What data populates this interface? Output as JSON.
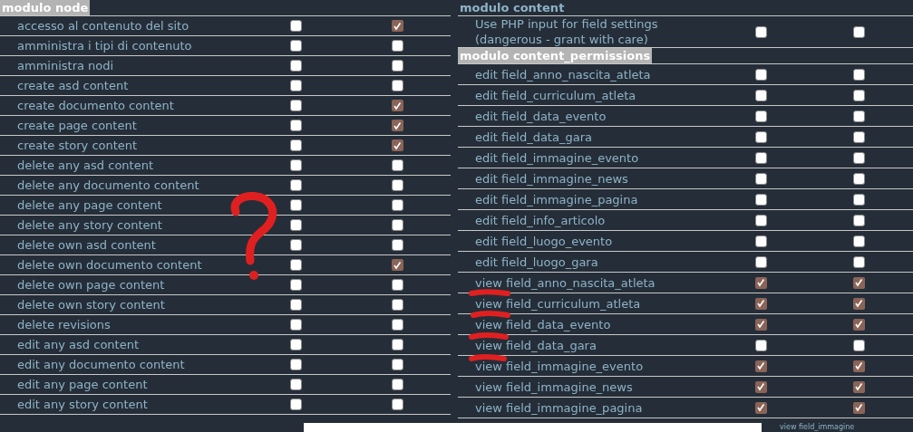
{
  "left_panel": {
    "sections": [
      {
        "title": "modulo node",
        "highlighted": true,
        "rows": [
          {
            "label": "accesso al contenuto del sito",
            "checkboxes": [
              {
                "checked": false
              },
              {
                "checked": true
              }
            ]
          },
          {
            "label": "amministra i tipi di contenuto",
            "checkboxes": [
              {
                "checked": false
              },
              {
                "checked": false
              }
            ]
          },
          {
            "label": "amministra nodi",
            "checkboxes": [
              {
                "checked": false
              },
              {
                "checked": false
              }
            ]
          },
          {
            "label": "create asd content",
            "checkboxes": [
              {
                "checked": false
              },
              {
                "checked": false
              }
            ]
          },
          {
            "label": "create documento content",
            "checkboxes": [
              {
                "checked": false
              },
              {
                "checked": true
              }
            ]
          },
          {
            "label": "create page content",
            "checkboxes": [
              {
                "checked": false
              },
              {
                "checked": true
              }
            ]
          },
          {
            "label": "create story content",
            "checkboxes": [
              {
                "checked": false
              },
              {
                "checked": true
              }
            ]
          },
          {
            "label": "delete any asd content",
            "checkboxes": [
              {
                "checked": false
              },
              {
                "checked": false
              }
            ]
          },
          {
            "label": "delete any documento content",
            "checkboxes": [
              {
                "checked": false
              },
              {
                "checked": false
              }
            ]
          },
          {
            "label": "delete any page content",
            "checkboxes": [
              {
                "checked": false
              },
              {
                "checked": false
              }
            ]
          },
          {
            "label": "delete any story content",
            "checkboxes": [
              {
                "checked": false
              },
              {
                "checked": false
              }
            ]
          },
          {
            "label": "delete own asd content",
            "checkboxes": [
              {
                "checked": false
              },
              {
                "checked": false
              }
            ]
          },
          {
            "label": "delete own documento content",
            "checkboxes": [
              {
                "checked": false
              },
              {
                "checked": true
              }
            ]
          },
          {
            "label": "delete own page content",
            "checkboxes": [
              {
                "checked": false
              },
              {
                "checked": false
              }
            ]
          },
          {
            "label": "delete own story content",
            "checkboxes": [
              {
                "checked": false
              },
              {
                "checked": false
              }
            ]
          },
          {
            "label": "delete revisions",
            "checkboxes": [
              {
                "checked": false
              },
              {
                "checked": false
              }
            ]
          },
          {
            "label": "edit any asd content",
            "checkboxes": [
              {
                "checked": false
              },
              {
                "checked": false
              }
            ]
          },
          {
            "label": "edit any documento content",
            "checkboxes": [
              {
                "checked": false
              },
              {
                "checked": false
              }
            ]
          },
          {
            "label": "edit any page content",
            "checkboxes": [
              {
                "checked": false
              },
              {
                "checked": false
              }
            ]
          },
          {
            "label": "edit any story content",
            "checkboxes": [
              {
                "checked": false
              },
              {
                "checked": false
              }
            ]
          }
        ]
      }
    ]
  },
  "right_panel": {
    "sections": [
      {
        "title": "modulo content",
        "highlighted": false,
        "rows": [
          {
            "label": "Use PHP input for field settings (dangerous - grant with care)",
            "checkboxes": [
              {
                "checked": false
              },
              {
                "checked": false
              }
            ]
          }
        ]
      },
      {
        "title": "modulo content_permissions",
        "highlighted": true,
        "rows": [
          {
            "label": "edit field_anno_nascita_atleta",
            "checkboxes": [
              {
                "checked": false
              },
              {
                "checked": false
              }
            ]
          },
          {
            "label": "edit field_curriculum_atleta",
            "checkboxes": [
              {
                "checked": false
              },
              {
                "checked": false
              }
            ]
          },
          {
            "label": "edit field_data_evento",
            "checkboxes": [
              {
                "checked": false
              },
              {
                "checked": false
              }
            ]
          },
          {
            "label": "edit field_data_gara",
            "checkboxes": [
              {
                "checked": false
              },
              {
                "checked": false
              }
            ]
          },
          {
            "label": "edit field_immagine_evento",
            "checkboxes": [
              {
                "checked": false
              },
              {
                "checked": false
              }
            ]
          },
          {
            "label": "edit field_immagine_news",
            "checkboxes": [
              {
                "checked": false
              },
              {
                "checked": false
              }
            ]
          },
          {
            "label": "edit field_immagine_pagina",
            "checkboxes": [
              {
                "checked": false
              },
              {
                "checked": false
              }
            ]
          },
          {
            "label": "edit field_info_articolo",
            "checkboxes": [
              {
                "checked": false
              },
              {
                "checked": false
              }
            ]
          },
          {
            "label": "edit field_luogo_evento",
            "checkboxes": [
              {
                "checked": false
              },
              {
                "checked": false
              }
            ]
          },
          {
            "label": "edit field_luogo_gara",
            "checkboxes": [
              {
                "checked": false
              },
              {
                "checked": false
              }
            ]
          },
          {
            "label": "view field_anno_nascita_atleta",
            "checkboxes": [
              {
                "checked": true
              },
              {
                "checked": true
              }
            ]
          },
          {
            "label": "view field_curriculum_atleta",
            "checkboxes": [
              {
                "checked": true
              },
              {
                "checked": true
              }
            ]
          },
          {
            "label": "view field_data_evento",
            "checkboxes": [
              {
                "checked": true
              },
              {
                "checked": true
              }
            ]
          },
          {
            "label": "view field_data_gara",
            "checkboxes": [
              {
                "checked": false
              },
              {
                "checked": false
              }
            ]
          },
          {
            "label": "view field_immagine_evento",
            "checkboxes": [
              {
                "checked": true
              },
              {
                "checked": true
              }
            ]
          },
          {
            "label": "view field_immagine_news",
            "checkboxes": [
              {
                "checked": true
              },
              {
                "checked": true
              }
            ]
          },
          {
            "label": "view field_immagine_pagina",
            "checkboxes": [
              {
                "checked": true
              },
              {
                "checked": true
              }
            ]
          }
        ]
      }
    ]
  },
  "bottom_strip": {
    "text": "view field_immagine"
  }
}
